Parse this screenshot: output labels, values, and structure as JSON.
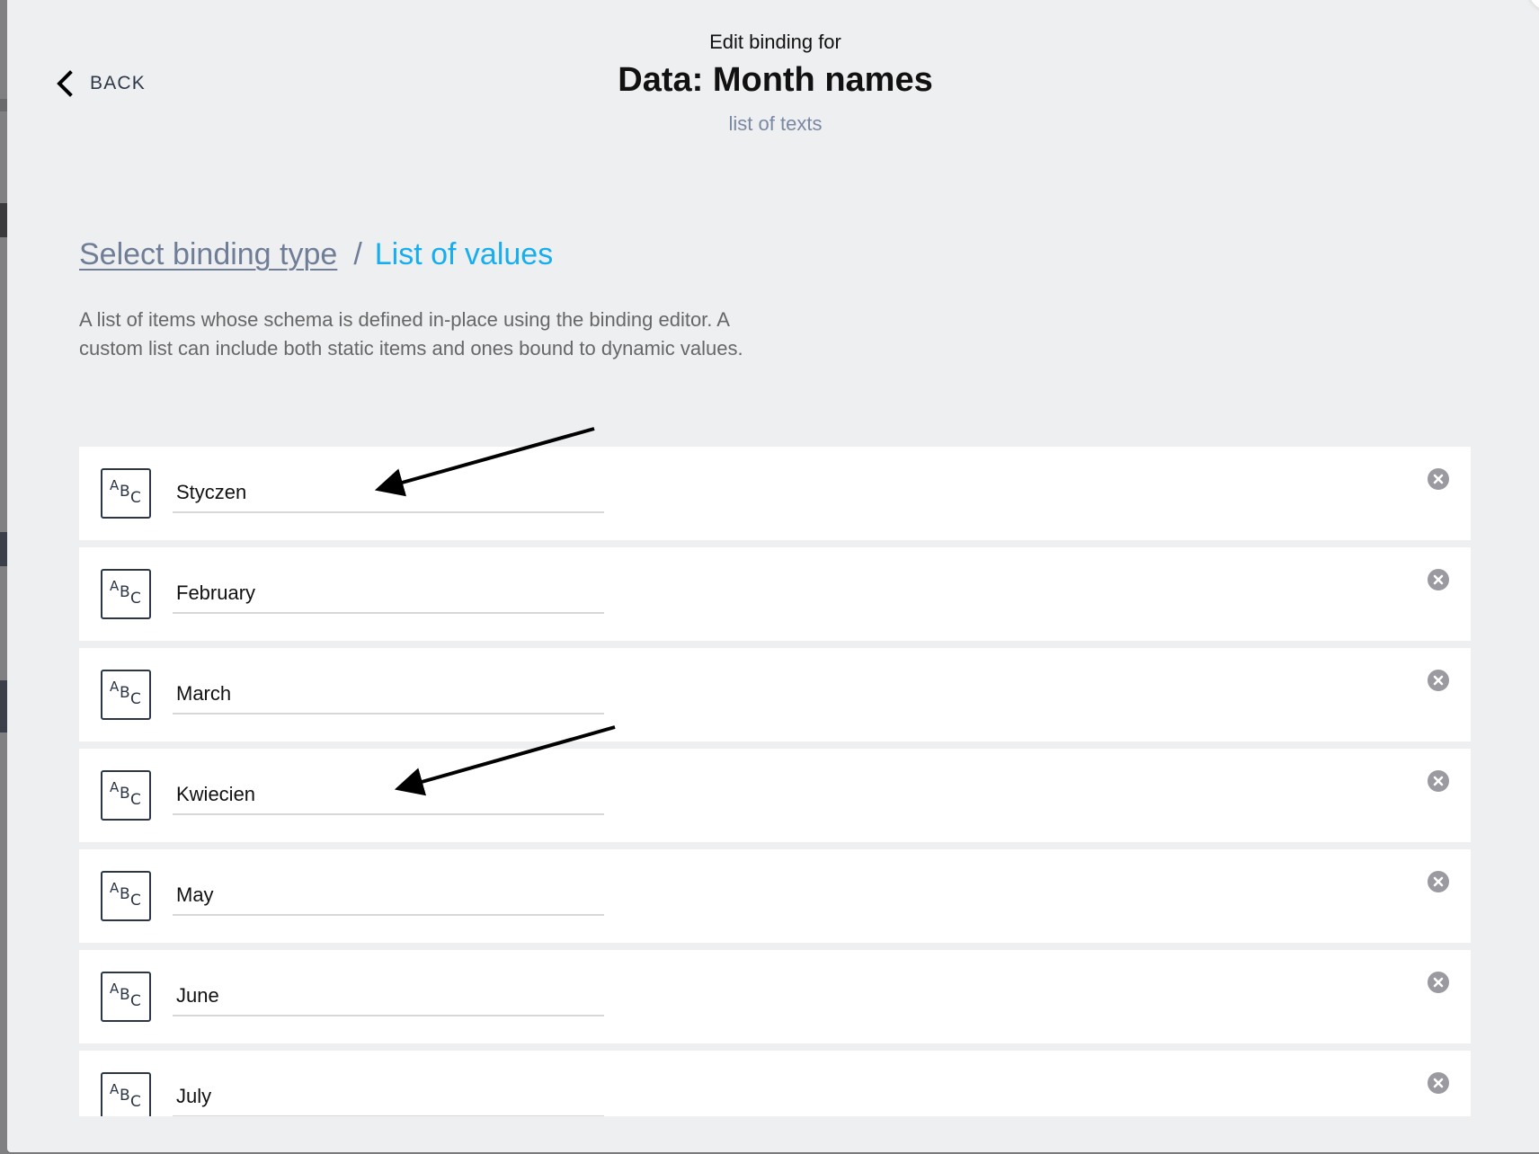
{
  "header": {
    "pretitle": "Edit binding for",
    "title": "Data: Month names",
    "subtitle": "list of texts"
  },
  "back": {
    "label": "BACK",
    "icon": "chevron-left-icon"
  },
  "breadcrumb": {
    "link": "Select binding type",
    "separator": "/",
    "current": "List of values"
  },
  "description": "A list of items whose schema is defined in-place using the binding editor. A custom list can include both static items and ones bound to dynamic values.",
  "items": [
    {
      "value": "Styczen",
      "type_icon": "text-type-icon"
    },
    {
      "value": "February",
      "type_icon": "text-type-icon"
    },
    {
      "value": "March",
      "type_icon": "text-type-icon"
    },
    {
      "value": "Kwiecien",
      "type_icon": "text-type-icon"
    },
    {
      "value": "May",
      "type_icon": "text-type-icon"
    },
    {
      "value": "June",
      "type_icon": "text-type-icon"
    },
    {
      "value": "July",
      "type_icon": "text-type-icon"
    }
  ],
  "type_icon_glyphs": {
    "a": "A",
    "b": "B",
    "c": "C"
  },
  "colors": {
    "accent": "#17aef0",
    "link": "#6f7d96",
    "background": "#eeeff1",
    "card": "#ffffff",
    "remove_icon": "#9a9aa0"
  },
  "annotations": [
    {
      "type": "arrow",
      "points_to_item": 0
    },
    {
      "type": "arrow",
      "points_to_item": 3
    }
  ]
}
